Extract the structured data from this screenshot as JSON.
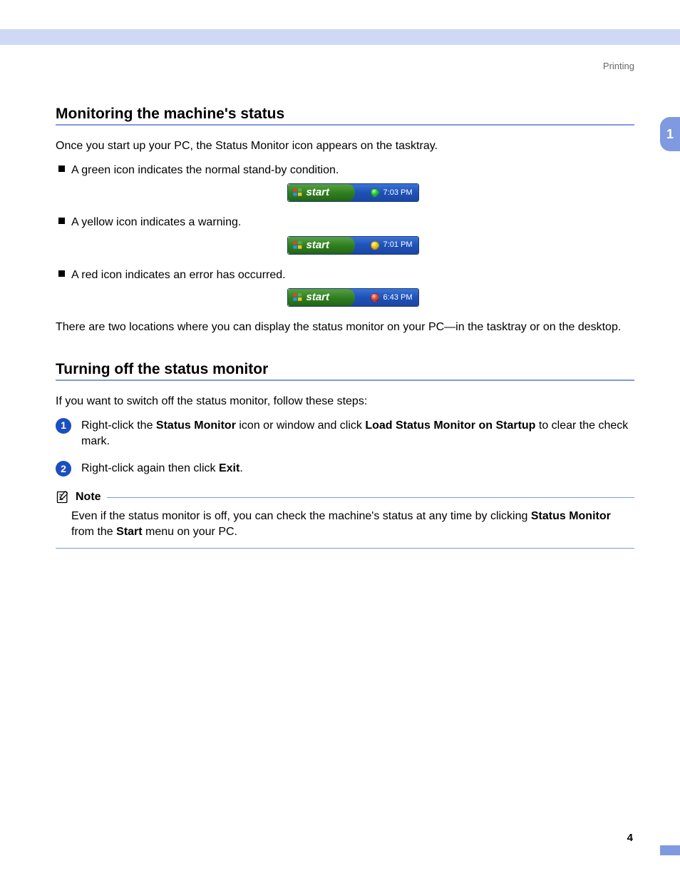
{
  "header": {
    "section": "Printing"
  },
  "side_tab": "1",
  "page_number": "4",
  "section1": {
    "title": "Monitoring the machine's status",
    "intro": "Once you start up your PC, the Status Monitor icon appears on the tasktray.",
    "bullets": [
      {
        "text": "A green icon indicates the normal stand-by condition.",
        "time": "7:03 PM",
        "color": "green"
      },
      {
        "text": "A yellow icon indicates a warning.",
        "time": "7:01 PM",
        "color": "yellow"
      },
      {
        "text": "A red icon indicates an error has occurred.",
        "time": "6:43 PM",
        "color": "red"
      }
    ],
    "start_label": "start",
    "outro": "There are two locations where you can display the status monitor on your PC—in the tasktray or on the desktop."
  },
  "section2": {
    "title": "Turning off the status monitor",
    "intro": "If you want to switch off the status monitor, follow these steps:",
    "steps": [
      {
        "num": "1",
        "pre": "Right-click the ",
        "b1": "Status Monitor",
        "mid": " icon or window and click ",
        "b2": "Load Status Monitor on Startup",
        "post": " to clear the check mark."
      },
      {
        "num": "2",
        "pre": "Right-click again then click ",
        "b1": "Exit",
        "mid": "",
        "b2": "",
        "post": "."
      }
    ],
    "note": {
      "label": "Note",
      "pre": "Even if the status monitor is off, you can check the machine's status at any time by clicking ",
      "b1": "Status Monitor",
      "mid": " from the ",
      "b2": "Start",
      "post": " menu on your PC."
    }
  }
}
